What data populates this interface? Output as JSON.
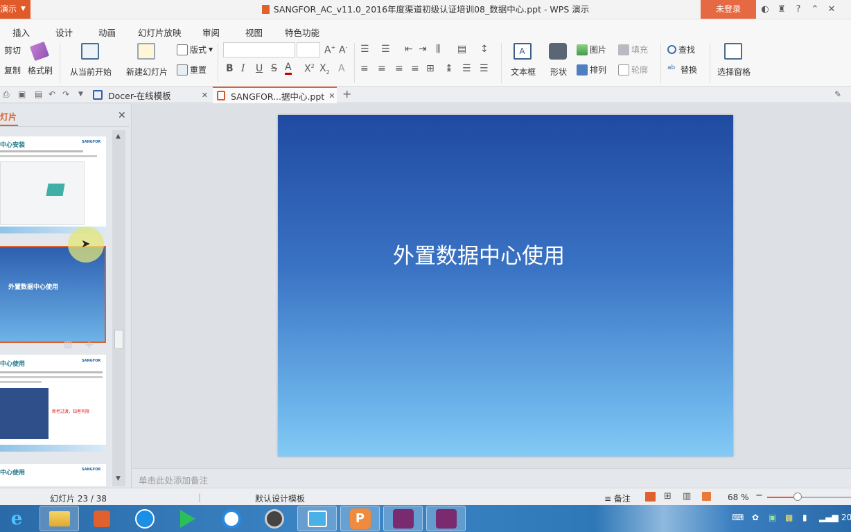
{
  "titlebar": {
    "app_menu": "演示",
    "doc_title": "SANGFOR_AC_v11.0_2016年度渠道初级认证培训08_数据中心.ppt - WPS 演示",
    "login": "未登录"
  },
  "menu_tabs": [
    "插入",
    "设计",
    "动画",
    "幻灯片放映",
    "审阅",
    "视图",
    "特色功能"
  ],
  "ribbon": {
    "cut": "剪切",
    "copy": "复制",
    "format_painter": "格式刷",
    "from_current": "从当前开始",
    "new_slide": "新建幻灯片",
    "layout": "版式",
    "reset": "重置",
    "textbox": "文本框",
    "shape": "形状",
    "picture": "图片",
    "arrange": "排列",
    "fill": "填充",
    "outline": "轮廓",
    "find": "查找",
    "replace": "替换",
    "selection_pane": "选择窗格"
  },
  "doc_tabs": [
    {
      "label": "Docer-在线模板"
    },
    {
      "label": "SANGFOR...据中心.ppt"
    }
  ],
  "left_panel": {
    "tab_label": "灯片",
    "thumb1_title": "中心安装",
    "thumb2_title": "外置数据中心使用",
    "thumb3_title": "中心使用",
    "thumb3_note": "新老过渡，知者有限",
    "thumb4_title": "中心使用",
    "logo_text": "SANGFOR"
  },
  "slide": {
    "title": "外置数据中心使用"
  },
  "notes": {
    "placeholder": "单击此处添加备注"
  },
  "statusbar": {
    "slide_counter": "幻灯片 23 / 38",
    "template": "默认设计模板",
    "notes_btn": "备注",
    "zoom": "68 %"
  },
  "taskbar": {
    "clock_partial": "20"
  },
  "colors": {
    "accent": "#e0602e",
    "login_bg": "#e56a43",
    "slide_top": "#1f4aa1",
    "slide_bottom": "#84caf5"
  }
}
